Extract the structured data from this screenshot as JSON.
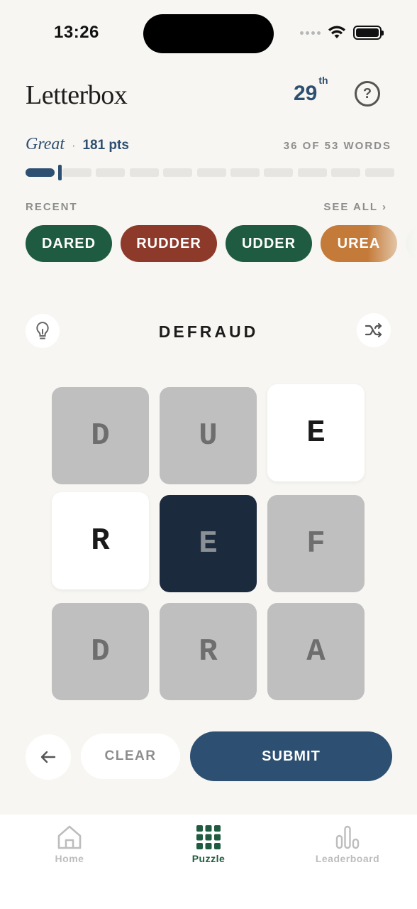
{
  "status_bar": {
    "time": "13:26"
  },
  "header": {
    "title": "Letterbox",
    "rank_number": "29",
    "rank_suffix": "th",
    "help_label": "?"
  },
  "score": {
    "rating": "Great",
    "separator": "·",
    "points": "181 pts",
    "words_found": "36 OF 53 WORDS",
    "progress_fraction": 0.08
  },
  "recent": {
    "label": "RECENT",
    "see_all": "SEE ALL ›",
    "words": [
      {
        "word": "DARED",
        "color": "#1f5b40"
      },
      {
        "word": "RUDDER",
        "color": "#8e3a2a"
      },
      {
        "word": "UDDER",
        "color": "#1f5b40"
      },
      {
        "word": "UREA",
        "color": "#c47a38"
      }
    ]
  },
  "puzzle": {
    "current_word": "DEFRAUD",
    "hint_icon": "lightbulb-icon",
    "shuffle_icon": "shuffle-icon",
    "tiles": [
      {
        "letter": "D",
        "state": "used"
      },
      {
        "letter": "U",
        "state": "used"
      },
      {
        "letter": "E",
        "state": "available"
      },
      {
        "letter": "R",
        "state": "available"
      },
      {
        "letter": "E",
        "state": "center"
      },
      {
        "letter": "F",
        "state": "used"
      },
      {
        "letter": "D",
        "state": "used"
      },
      {
        "letter": "R",
        "state": "used"
      },
      {
        "letter": "A",
        "state": "used"
      }
    ]
  },
  "actions": {
    "back_icon": "arrow-left-icon",
    "clear_label": "CLEAR",
    "submit_label": "SUBMIT"
  },
  "tabbar": {
    "items": [
      {
        "label": "Home",
        "icon": "home-icon",
        "active": false
      },
      {
        "label": "Puzzle",
        "icon": "grid-icon",
        "active": true
      },
      {
        "label": "Leaderboard",
        "icon": "bar-chart-icon",
        "active": false
      }
    ]
  },
  "colors": {
    "accent": "#2d4f71",
    "green": "#1f5b40",
    "red": "#8e3a2a",
    "orange": "#c47a38",
    "background": "#f7f6f2"
  }
}
